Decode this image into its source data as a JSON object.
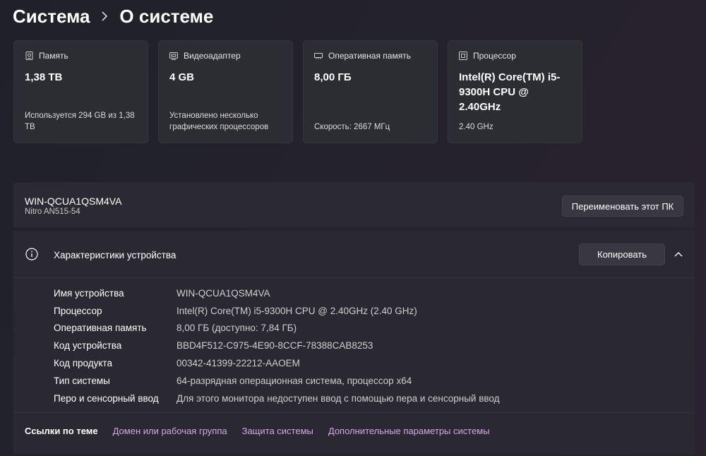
{
  "breadcrumb": {
    "parent": "Система",
    "current": "О системе"
  },
  "cards": [
    {
      "icon": "storage-icon",
      "title": "Память",
      "value": "1,38 TB",
      "subtitle": "Используется 294 GB из 1,38 TB"
    },
    {
      "icon": "display-adapter-icon",
      "title": "Видеоадаптер",
      "value": "4 GB",
      "subtitle": "Установлено несколько графических процессоров"
    },
    {
      "icon": "ram-icon",
      "title": "Оперативная память",
      "value": "8,00 ГБ",
      "subtitle": "Скорость: 2667 МГц"
    },
    {
      "icon": "processor-icon",
      "title": "Процессор",
      "value": "Intel(R) Core(TM) i5-9300H CPU @ 2.40GHz",
      "subtitle": "2.40 GHz"
    }
  ],
  "pc": {
    "name": "WIN-QCUA1QSM4VA",
    "model": "Nitro AN515-54",
    "rename_label": "Переименовать этот ПК"
  },
  "specs": {
    "title": "Характеристики устройства",
    "copy_label": "Копировать",
    "rows": [
      {
        "key": "Имя устройства",
        "value": "WIN-QCUA1QSM4VA"
      },
      {
        "key": "Процессор",
        "value": "Intel(R) Core(TM) i5-9300H CPU @ 2.40GHz (2.40 GHz)"
      },
      {
        "key": "Оперативная память",
        "value": "8,00 ГБ (доступно: 7,84 ГБ)"
      },
      {
        "key": "Код устройства",
        "value": "BBD4F512-C975-4E90-8CCF-78388CAB8253"
      },
      {
        "key": "Код продукта",
        "value": "00342-41399-22212-AAOEM"
      },
      {
        "key": "Тип системы",
        "value": "64-разрядная операционная система, процессор x64"
      },
      {
        "key": "Перо и сенсорный ввод",
        "value": "Для этого монитора недоступен ввод с помощью пера и сенсорный ввод"
      }
    ]
  },
  "related": {
    "label": "Ссылки по теме",
    "links": [
      "Домен или рабочая группа",
      "Защита системы",
      "Дополнительные параметры системы"
    ]
  },
  "colors": {
    "accent_link": "#d5a8e8",
    "card_bg": "#2c2c33",
    "panel_bg": "#2a2830"
  }
}
